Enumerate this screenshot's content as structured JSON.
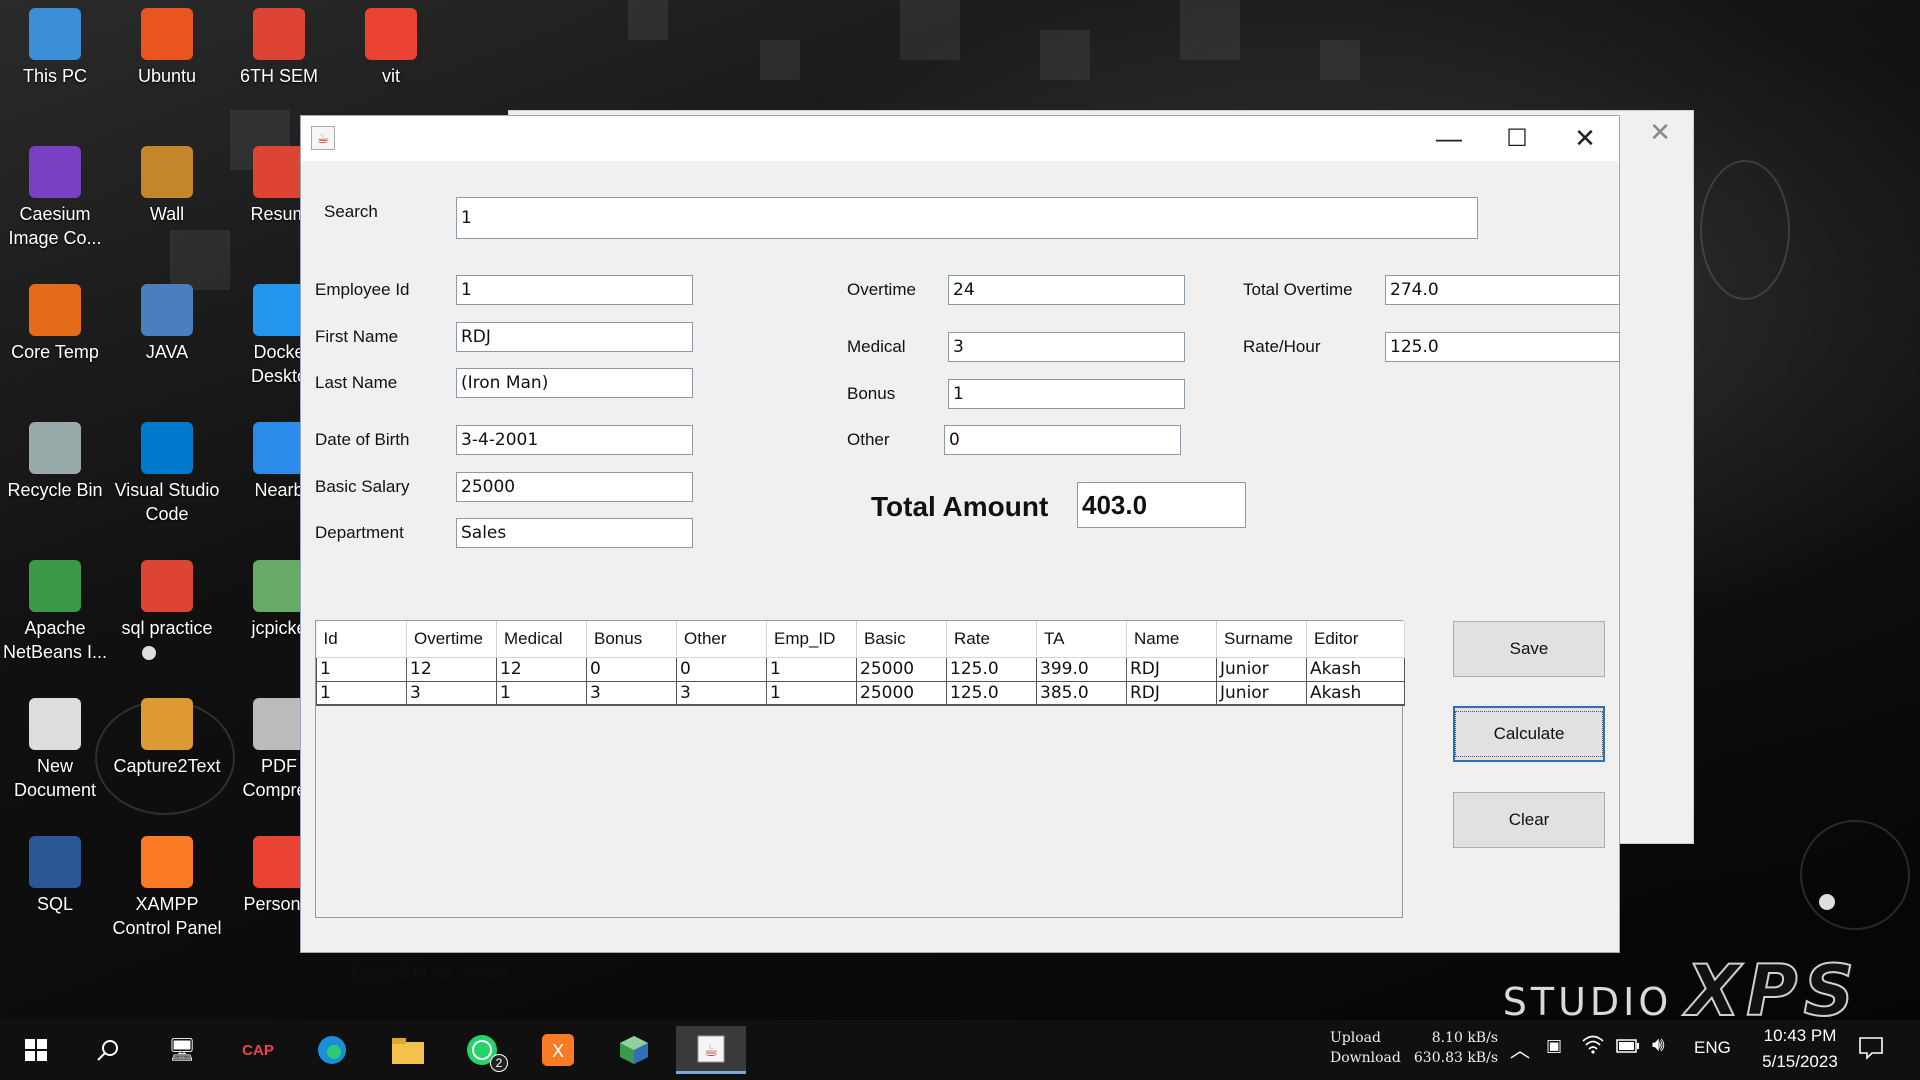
{
  "desktop": {
    "icons": [
      {
        "label": "This PC",
        "icon": "this-pc-icon",
        "color": "#3a8fd6"
      },
      {
        "label": "Ubuntu",
        "icon": "ubuntu-icon",
        "color": "#e95420"
      },
      {
        "label": "6TH SEM",
        "icon": "pdf-shortcut-icon",
        "color": "#d43"
      },
      {
        "label": "vit",
        "icon": "gmail-icon",
        "color": "#ea4335"
      },
      {
        "label": "Caesium Image Co...",
        "icon": "caesium-icon",
        "color": "#7b3fc4"
      },
      {
        "label": "Wall",
        "icon": "image-file-icon",
        "color": "#c5862b"
      },
      {
        "label": "Resum",
        "icon": "pdf-shortcut-icon",
        "color": "#d43"
      },
      {
        "label": "Core Temp",
        "icon": "core-temp-icon",
        "color": "#e36b1a"
      },
      {
        "label": "JAVA",
        "icon": "document-icon",
        "color": "#4a7fbf"
      },
      {
        "label": "Docke Deskto",
        "icon": "docker-icon",
        "color": "#2496ed"
      },
      {
        "label": "Recycle Bin",
        "icon": "recycle-bin-icon",
        "color": "#9aa"
      },
      {
        "label": "Visual Studio Code",
        "icon": "vscode-icon",
        "color": "#007acc"
      },
      {
        "label": "Nearb",
        "icon": "nearby-share-icon",
        "color": "#2a8be8"
      },
      {
        "label": "Apache NetBeans I...",
        "icon": "netbeans-icon",
        "color": "#3b9a4a"
      },
      {
        "label": "sql practice",
        "icon": "pdf-icon",
        "color": "#d43"
      },
      {
        "label": "jcpicke",
        "icon": "jcpicker-icon",
        "color": "#6a6"
      },
      {
        "label": "New Document",
        "icon": "blank-document-icon",
        "color": "#ddd"
      },
      {
        "label": "Capture2Text",
        "icon": "capture2text-icon",
        "color": "#d93"
      },
      {
        "label": "PDF Compres",
        "icon": "pdf-compressor-icon",
        "color": "#bbb"
      },
      {
        "label": "SQL",
        "icon": "word-document-icon",
        "color": "#2b5797"
      },
      {
        "label": "XAMPP Control Panel",
        "icon": "xampp-icon",
        "color": "#fb7a24"
      },
      {
        "label": "Personal",
        "icon": "gmail-icon",
        "color": "#ea4335"
      }
    ],
    "brand_a": "STUDIO",
    "brand_b": "XPS"
  },
  "window": {
    "app_icon": "java-icon",
    "minimize": "—",
    "maximize": "☐",
    "close": "✕"
  },
  "form": {
    "search": {
      "label": "Search",
      "value": "1"
    },
    "employee_id": {
      "label": "Employee Id",
      "value": "1"
    },
    "first_name": {
      "label": "First Name",
      "value": "RDJ"
    },
    "last_name": {
      "label": "Last Name",
      "value": "(Iron Man)"
    },
    "dob": {
      "label": "Date of Birth",
      "value": "3-4-2001"
    },
    "basic_salary": {
      "label": "Basic Salary",
      "value": "25000"
    },
    "department": {
      "label": "Department",
      "value": "Sales"
    },
    "overtime": {
      "label": "Overtime",
      "value": "24"
    },
    "medical": {
      "label": "Medical",
      "value": "3"
    },
    "bonus": {
      "label": "Bonus",
      "value": "1"
    },
    "other": {
      "label": "Other",
      "value": "0"
    },
    "total_overtime": {
      "label": "Total Overtime",
      "value": "274.0"
    },
    "rate_hour": {
      "label": "Rate/Hour",
      "value": "125.0"
    },
    "total_amount": {
      "label": "Total Amount",
      "value": "403.0"
    }
  },
  "table": {
    "columns": [
      "Id",
      "Overtime",
      "Medical",
      "Bonus",
      "Other",
      "Emp_ID",
      "Basic",
      "Rate",
      "TA",
      "Name",
      "Surname",
      "Editor"
    ],
    "rows": [
      [
        "1",
        "12",
        "12",
        "0",
        "0",
        "1",
        "25000",
        "125.0",
        "399.0",
        "RDJ",
        "Junior",
        "Akash"
      ],
      [
        "1",
        "3",
        "1",
        "3",
        "3",
        "1",
        "25000",
        "125.0",
        "385.0",
        "RDJ",
        "Junior",
        "Akash"
      ]
    ]
  },
  "buttons": {
    "save": "Save",
    "calculate": "Calculate",
    "clear": "Clear"
  },
  "status": {
    "logged_in_label": "Logged In As",
    "user": "Akash"
  },
  "taskbar": {
    "items": [
      "start-icon",
      "search-icon",
      "task-manager-icon",
      "capture2text-icon",
      "edge-icon",
      "file-explorer-icon",
      "whatsapp-icon",
      "xampp-icon",
      "netbeans-icon",
      "java-icon"
    ],
    "whatsapp_badge": "2",
    "upload_label": "Upload",
    "download_label": "Download",
    "upload_speed": "8.10 kB/s",
    "download_speed": "630.83 kB/s",
    "language": "ENG",
    "time": "10:43 PM",
    "date": "5/15/2023"
  }
}
